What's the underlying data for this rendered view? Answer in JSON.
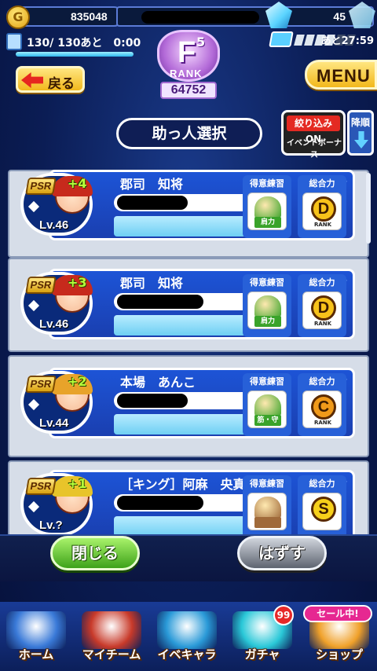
{
  "header": {
    "coins": "835048",
    "gems": "45",
    "stamina": "130/ 130あと　0:00",
    "stamina_level": 1.0,
    "ticket_timer": "あと27:59",
    "tickets_filled": 4,
    "tickets_total": 6,
    "rank_letter": "F",
    "rank_sup": "5",
    "rank_label": "RANK",
    "rank_value": "64752",
    "back_label": "戻る",
    "menu_label": "MENU"
  },
  "toolbar": {
    "title": "助っ人選択",
    "filter_top": "絞り込みON",
    "filter_bottom": "イベントボーナス",
    "sort_label": "降順"
  },
  "cards": [
    {
      "name": "郡司　知将",
      "badge": "PSR",
      "plus": "+4",
      "level": "Lv.46",
      "practice_header": "得意練習",
      "practice_label": "肩力",
      "practice_color": "#3aa32a",
      "power_header": "総合力",
      "grade": "D",
      "grade_sub": "RANK",
      "grade_color": "#f7c21a",
      "hair": "#c72a1c"
    },
    {
      "name": "郡司　知将",
      "badge": "PSR",
      "plus": "+3",
      "level": "Lv.46",
      "practice_header": "得意練習",
      "practice_label": "肩力",
      "practice_color": "#3aa32a",
      "power_header": "総合力",
      "grade": "D",
      "grade_sub": "RANK",
      "grade_color": "#f7c21a",
      "hair": "#c72a1c"
    },
    {
      "name": "本場　あんこ",
      "badge": "PSR",
      "plus": "+2",
      "level": "Lv.44",
      "practice_header": "得意練習",
      "practice_label": "筋・守",
      "practice_color": "#3aa32a",
      "power_header": "総合力",
      "grade": "C",
      "grade_sub": "RANK",
      "grade_color": "#f09a1a",
      "hair": "#e8a32a"
    },
    {
      "name": "［キング］阿麻　央真",
      "badge": "PSR",
      "plus": "+1",
      "level": "Lv.?",
      "practice_header": "得意練習",
      "practice_label": "",
      "practice_color": "#a06a3a",
      "power_header": "総合力",
      "grade": "S",
      "grade_sub": "",
      "grade_color": "#f7d01a",
      "hair": "#e8c42a"
    }
  ],
  "actions": {
    "close_label": "閉じる",
    "remove_label": "はずす"
  },
  "nav": {
    "items": [
      {
        "label": "ホーム",
        "color": "#3a7ad8"
      },
      {
        "label": "マイチーム",
        "color": "#c83a2a"
      },
      {
        "label": "イベキャラ",
        "color": "#2a9ad8"
      },
      {
        "label": "ガチャ",
        "color": "#2ac8d8"
      },
      {
        "label": "ショップ",
        "color": "#f0a12a"
      }
    ],
    "gacha_badge": "99",
    "shop_badge": "セール中!"
  }
}
